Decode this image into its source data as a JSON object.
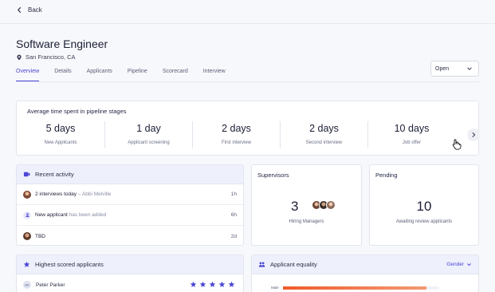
{
  "nav": {
    "back_label": "Back"
  },
  "job": {
    "title": "Software Engineer",
    "location": "San Francisco, CA",
    "status": "Open"
  },
  "tabs": [
    {
      "label": "Overview",
      "active": true
    },
    {
      "label": "Details"
    },
    {
      "label": "Applicants"
    },
    {
      "label": "Pipeline"
    },
    {
      "label": "Scorecard"
    },
    {
      "label": "Interview"
    }
  ],
  "pipeline": {
    "title": "Average time spent in pipeline stages",
    "stages": [
      {
        "value": "5 days",
        "label": "New Applicants"
      },
      {
        "value": "1 day",
        "label": "Applicant screening"
      },
      {
        "value": "2 days",
        "label": "First interview"
      },
      {
        "value": "2 days",
        "label": "Second interview"
      },
      {
        "value": "10 days",
        "label": "Job offer"
      }
    ]
  },
  "recent_activity": {
    "title": "Recent activity",
    "rows": [
      {
        "strong": "2 interviews today",
        "muted": " – Abbi Melville",
        "time": "1h"
      },
      {
        "strong": "New applicant",
        "muted": " has been added",
        "time": "6h"
      },
      {
        "strong": "TBD",
        "muted": "",
        "time": "2d"
      }
    ]
  },
  "supervisors": {
    "title": "Supervisors",
    "count": "3",
    "subtitle": "Hiring Managers"
  },
  "pending": {
    "title": "Pending",
    "count": "10",
    "subtitle": "Awaiting review applicants"
  },
  "highest_scored": {
    "title": "Highest scored applicants",
    "rows": [
      {
        "initials": "PP",
        "name": "Peter Parker",
        "stars": 5
      }
    ]
  },
  "equality": {
    "title": "Applicant equality",
    "filter": "Gender",
    "bars": [
      {
        "label": "Male",
        "fraction": 0.92
      }
    ]
  },
  "colors": {
    "accent": "#4b46d6",
    "bar": "#f05a29",
    "card_head_bg": "#eef0fc"
  }
}
